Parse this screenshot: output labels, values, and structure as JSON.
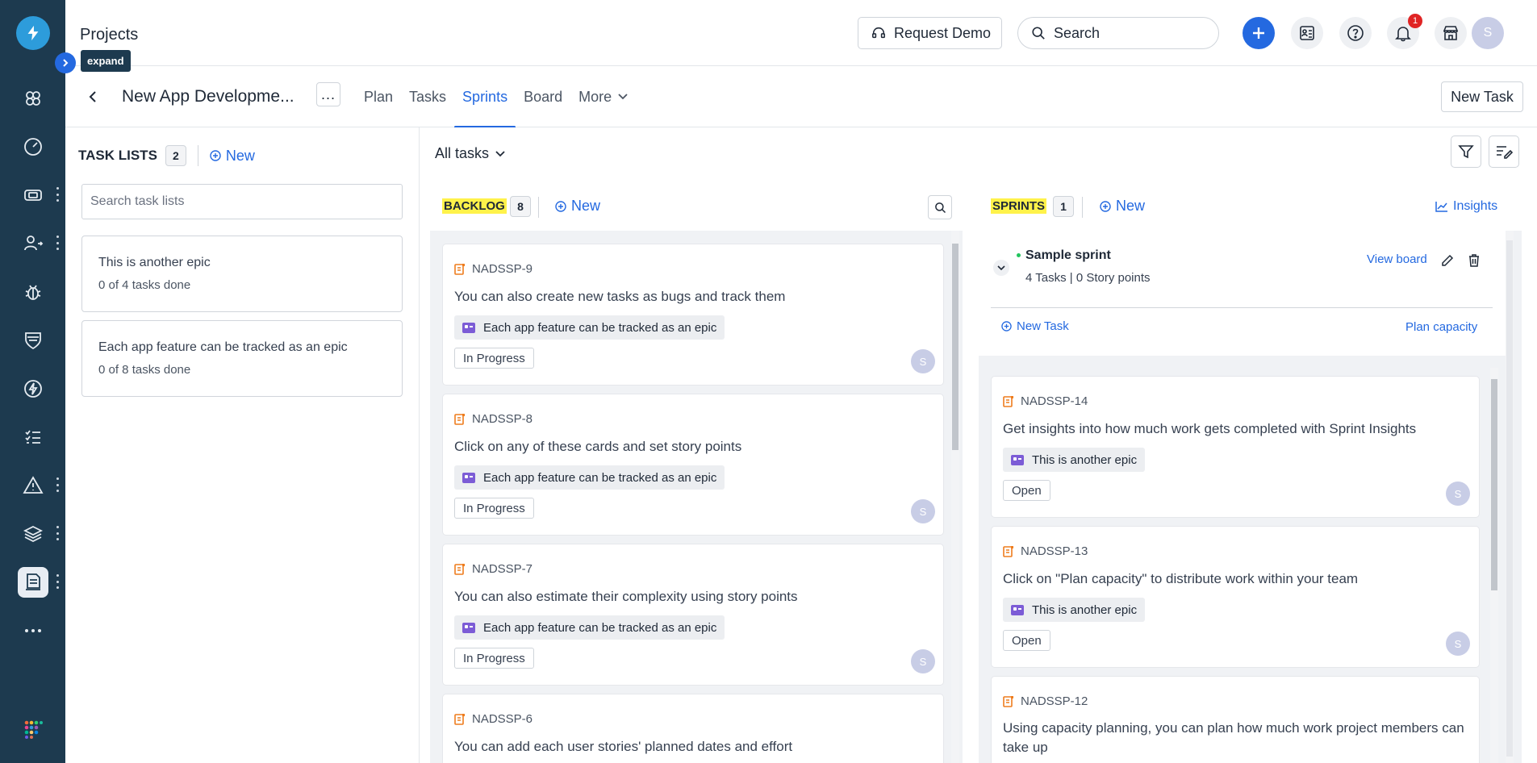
{
  "topbar": {
    "title": "Projects",
    "request_demo": "Request Demo",
    "search_label": "Search",
    "notification_count": "1",
    "avatar_initial": "S"
  },
  "expand_tooltip": "expand",
  "project_nav": {
    "name": "New App Developme...",
    "more_dots": "...",
    "tabs": [
      {
        "label": "Plan"
      },
      {
        "label": "Tasks"
      },
      {
        "label": "Sprints",
        "active": true
      },
      {
        "label": "Board"
      },
      {
        "label": "More"
      }
    ],
    "new_task": "New Task"
  },
  "task_lists": {
    "title": "TASK LISTS",
    "count": "2",
    "new_label": "New",
    "search_placeholder": "Search task lists",
    "items": [
      {
        "name": "This is another epic",
        "progress": "0 of 4 tasks done"
      },
      {
        "name": "Each app feature can be tracked as an epic",
        "progress": "0 of 8 tasks done"
      }
    ]
  },
  "filter": {
    "label": "All tasks"
  },
  "backlog": {
    "title": "BACKLOG",
    "count": "8",
    "new_label": "New",
    "tasks": [
      {
        "id": "NADSSP-9",
        "title": "You can also create new tasks as bugs and track them",
        "epic": "Each app feature can be tracked as an epic",
        "status": "In Progress",
        "assignee": "S"
      },
      {
        "id": "NADSSP-8",
        "title": "Click on any of these cards and set story points",
        "epic": "Each app feature can be tracked as an epic",
        "status": "In Progress",
        "assignee": "S"
      },
      {
        "id": "NADSSP-7",
        "title": "You can also estimate their complexity using story points",
        "epic": "Each app feature can be tracked as an epic",
        "status": "In Progress",
        "assignee": "S"
      },
      {
        "id": "NADSSP-6",
        "title": "You can add each user stories' planned dates and effort"
      }
    ]
  },
  "sprints": {
    "title": "SPRINTS",
    "count": "1",
    "new_label": "New",
    "insights_label": "Insights",
    "sprint": {
      "name": "Sample sprint",
      "summary": "4 Tasks | 0 Story points",
      "view_board": "View board",
      "new_task": "New Task",
      "plan_capacity": "Plan capacity"
    },
    "tasks": [
      {
        "id": "NADSSP-14",
        "title": "Get insights into how much work gets completed with Sprint Insights",
        "epic": "This is another epic",
        "status": "Open",
        "assignee": "S"
      },
      {
        "id": "NADSSP-13",
        "title": "Click on \"Plan capacity\" to distribute work within your team",
        "epic": "This is another epic",
        "status": "Open",
        "assignee": "S"
      },
      {
        "id": "NADSSP-12",
        "title": "Using capacity planning, you can plan how much work project members can take up"
      }
    ]
  },
  "colors": {
    "rail": "#1d3a4f",
    "accent": "#2469e0",
    "highlight": "#fff24a",
    "story_icon": "#ee7d1e",
    "epic_icon": "#7c5cd6"
  }
}
